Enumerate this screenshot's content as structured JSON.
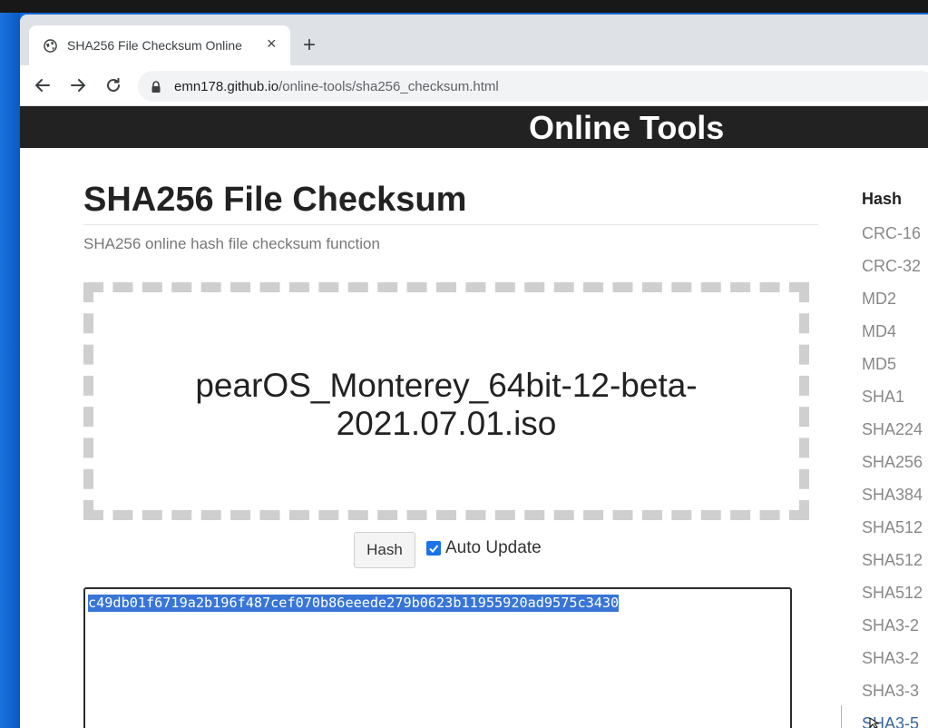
{
  "browser": {
    "tab_title": "SHA256 File Checksum Online",
    "tab_close": "×",
    "new_tab": "+",
    "url_host": "emn178.github.io",
    "url_path": "/online-tools/sha256_checksum.html"
  },
  "site": {
    "header_title": "Online Tools"
  },
  "page": {
    "title": "SHA256 File Checksum",
    "subtitle": "SHA256 online hash file checksum function",
    "dropzone_file": "pearOS_Monterey_64bit-12-beta-2021.07.01.iso",
    "hash_button": "Hash",
    "auto_update_label": "Auto Update",
    "auto_update_checked": true,
    "output_hash": "c49db01f6719a2b196f487cef070b86eeede279b0623b11955920ad9575c3430"
  },
  "sidebar": {
    "heading": "Hash",
    "items": [
      "CRC-16",
      "CRC-32",
      "MD2",
      "MD4",
      "MD5",
      "SHA1",
      "SHA224",
      "SHA256",
      "SHA384",
      "SHA512",
      "SHA512",
      "SHA512",
      "SHA3-2",
      "SHA3-2",
      "SHA3-3",
      "SHA3-5"
    ],
    "active_index": 15
  },
  "colors": {
    "accent": "#1a73e8",
    "header_bg": "#222222",
    "selection": "#3875d7",
    "sidebar_active": "#37669f"
  }
}
